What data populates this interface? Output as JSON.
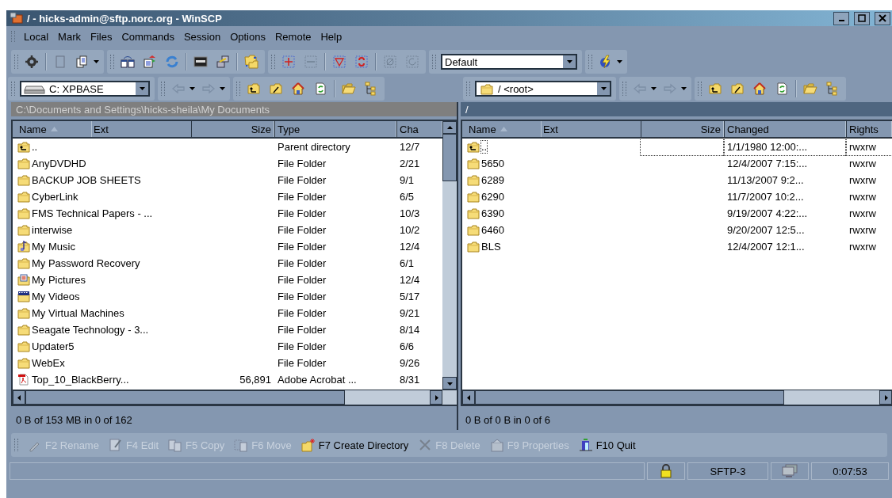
{
  "window": {
    "title": "/ - hicks-admin@sftp.norc.org - WinSCP"
  },
  "menu": [
    "Local",
    "Mark",
    "Files",
    "Commands",
    "Session",
    "Options",
    "Remote",
    "Help"
  ],
  "toolbar": {
    "transfer_settings": "Default"
  },
  "panels": [
    {
      "drive": "C: XPBASE",
      "path": "C:\\Documents and Settings\\hicks-sheila\\My Documents",
      "active": false,
      "columns": [
        {
          "label": "Name",
          "sorted": true
        },
        {
          "label": "Ext",
          "sorted": false
        },
        {
          "label": "Size",
          "sorted": false
        },
        {
          "label": "Type",
          "sorted": false
        },
        {
          "label": "Cha",
          "sorted": false
        }
      ],
      "rows": [
        {
          "kind": "parent",
          "name": "..",
          "details": [
            "Parent directory",
            "12/7"
          ],
          "focused": false
        },
        {
          "kind": "folder",
          "name": "AnyDVDHD",
          "details": [
            "File Folder",
            "2/21"
          ],
          "focused": false
        },
        {
          "kind": "folder",
          "name": "BACKUP JOB SHEETS",
          "details": [
            "File Folder",
            "9/1"
          ],
          "focused": false
        },
        {
          "kind": "folder",
          "name": "CyberLink",
          "details": [
            "File Folder",
            "6/5"
          ],
          "focused": false
        },
        {
          "kind": "folder",
          "name": "FMS Technical Papers - ...",
          "details": [
            "File Folder",
            "10/3"
          ],
          "focused": false
        },
        {
          "kind": "folder",
          "name": "interwise",
          "details": [
            "File Folder",
            "10/2"
          ],
          "focused": false
        },
        {
          "kind": "music",
          "name": "My Music",
          "details": [
            "File Folder",
            "12/4"
          ],
          "focused": false
        },
        {
          "kind": "folder",
          "name": "My Password Recovery",
          "details": [
            "File Folder",
            "6/1"
          ],
          "focused": false
        },
        {
          "kind": "pictures",
          "name": "My Pictures",
          "details": [
            "File Folder",
            "12/4"
          ],
          "focused": false
        },
        {
          "kind": "videos",
          "name": "My Videos",
          "details": [
            "File Folder",
            "5/17"
          ],
          "focused": false
        },
        {
          "kind": "folder",
          "name": "My Virtual Machines",
          "details": [
            "File Folder",
            "9/21"
          ],
          "focused": false
        },
        {
          "kind": "folder",
          "name": "Seagate Technology - 3...",
          "details": [
            "File Folder",
            "8/14"
          ],
          "focused": false
        },
        {
          "kind": "folder",
          "name": "Updater5",
          "details": [
            "File Folder",
            "6/6"
          ],
          "focused": false
        },
        {
          "kind": "folder",
          "name": "WebEx",
          "details": [
            "File Folder",
            "9/26"
          ],
          "focused": false
        },
        {
          "kind": "pdf",
          "name": "Top_10_BlackBerry...",
          "size": "56,891",
          "details": [
            "Adobe Acrobat ...",
            "8/31"
          ],
          "focused": false
        }
      ],
      "summary": "0 B of 153 MB in 0 of 162"
    },
    {
      "drive": "/ <root>",
      "path": "/",
      "active": true,
      "columns": [
        {
          "label": "Name",
          "sorted": true
        },
        {
          "label": "Ext",
          "sorted": false
        },
        {
          "label": "Size",
          "sorted": false
        },
        {
          "label": "Changed",
          "sorted": false
        },
        {
          "label": "Rights",
          "sorted": false
        }
      ],
      "rows": [
        {
          "kind": "parent",
          "name": "..",
          "details": [
            "1/1/1980 12:00:...",
            "rwxrw"
          ],
          "focused": true
        },
        {
          "kind": "folder",
          "name": "5650",
          "details": [
            "12/4/2007 7:15:...",
            "rwxrw"
          ],
          "focused": false
        },
        {
          "kind": "folder",
          "name": "6289",
          "details": [
            "11/13/2007 9:2...",
            "rwxrw"
          ],
          "focused": false
        },
        {
          "kind": "folder",
          "name": "6290",
          "details": [
            "11/7/2007 10:2...",
            "rwxrw"
          ],
          "focused": false
        },
        {
          "kind": "folder",
          "name": "6390",
          "details": [
            "9/19/2007 4:22:...",
            "rwxrw"
          ],
          "focused": false
        },
        {
          "kind": "folder",
          "name": "6460",
          "details": [
            "9/20/2007 12:5...",
            "rwxrw"
          ],
          "focused": false
        },
        {
          "kind": "folder",
          "name": "BLS",
          "details": [
            "12/4/2007 12:1...",
            "rwxrw"
          ],
          "focused": false
        }
      ],
      "summary": "0 B of 0 B in 0 of 6"
    }
  ],
  "commands": [
    {
      "kind": "rename",
      "label": "F2 Rename",
      "disabled": true
    },
    {
      "kind": "edit",
      "label": "F4 Edit",
      "disabled": true
    },
    {
      "kind": "copy",
      "label": "F5 Copy",
      "disabled": true
    },
    {
      "kind": "move",
      "label": "F6 Move",
      "disabled": true
    },
    {
      "kind": "mkdir",
      "label": "F7 Create Directory",
      "disabled": false
    },
    {
      "kind": "delete",
      "label": "F8 Delete",
      "disabled": true
    },
    {
      "kind": "properties",
      "label": "F9 Properties",
      "disabled": true
    },
    {
      "kind": "quit",
      "label": "F10 Quit",
      "disabled": false
    }
  ],
  "status_bar": {
    "protocol": "SFTP-3",
    "elapsed": "0:07:53"
  }
}
